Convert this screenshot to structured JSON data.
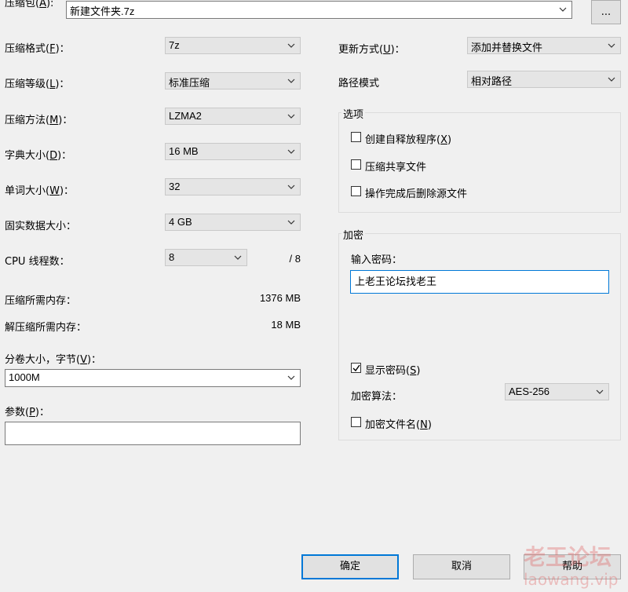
{
  "archive": {
    "label_prefix": "压缩包(",
    "label_key": "A",
    "label_suffix": "):",
    "value": "新建文件夹.7z",
    "browse_label": "..."
  },
  "left": {
    "format": {
      "label": "压缩格式(",
      "key": "F",
      "suffix": ")：",
      "value": "7z"
    },
    "level": {
      "label": "压缩等级(",
      "key": "L",
      "suffix": ")：",
      "value": "标准压缩"
    },
    "method": {
      "label": "压缩方法(",
      "key": "M",
      "suffix": ")：",
      "value": "LZMA2"
    },
    "dict": {
      "label": "字典大小(",
      "key": "D",
      "suffix": ")：",
      "value": "16 MB"
    },
    "word": {
      "label": "单词大小(",
      "key": "W",
      "suffix": ")：",
      "value": "32"
    },
    "solid": {
      "label": "固实数据大小：",
      "value": "4 GB"
    },
    "threads": {
      "label": "CPU 线程数：",
      "value": "8",
      "max": "/ 8"
    },
    "mem_compress": {
      "label": "压缩所需内存：",
      "value": "1376 MB"
    },
    "mem_decompress": {
      "label": "解压缩所需内存：",
      "value": "18 MB"
    },
    "split": {
      "label": "分卷大小，字节(",
      "key": "V",
      "suffix": ")：",
      "value": "1000M"
    },
    "params": {
      "label": "参数(",
      "key": "P",
      "suffix": ")：",
      "value": ""
    }
  },
  "right": {
    "update": {
      "label": "更新方式(",
      "key": "U",
      "suffix": ")：",
      "value": "添加并替换文件"
    },
    "path": {
      "label": "路径模式",
      "value": "相对路径"
    },
    "options": {
      "title": "选项",
      "sfx": {
        "label": "创建自释放程序(",
        "key": "X",
        "suffix": ")",
        "checked": false
      },
      "shared": {
        "label": "压缩共享文件",
        "checked": false
      },
      "delete": {
        "label": "操作完成后删除源文件",
        "checked": false
      }
    },
    "encryption": {
      "title": "加密",
      "password_label": "输入密码：",
      "password_value": "上老王论坛找老王",
      "show": {
        "label": "显示密码(",
        "key": "S",
        "suffix": ")",
        "checked": true
      },
      "algo_label": "加密算法：",
      "algo_value": "AES-256",
      "encnames": {
        "label": "加密文件名(",
        "key": "N",
        "suffix": ")",
        "checked": false
      }
    }
  },
  "buttons": {
    "ok": "确定",
    "cancel": "取消",
    "help": "帮助"
  },
  "watermark": {
    "line1": "老王论坛",
    "line2": "laowang.vip"
  }
}
